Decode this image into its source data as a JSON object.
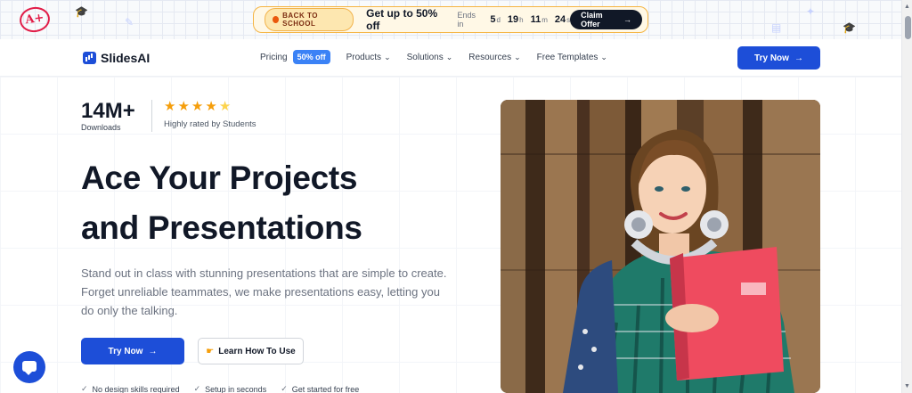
{
  "promo": {
    "tag": "BACK TO SCHOOL",
    "offer_prefix": "Get up to ",
    "offer_highlight": "50% off",
    "ends_label": "Ends in",
    "countdown": [
      {
        "value": "5",
        "unit": "d"
      },
      {
        "value": "19",
        "unit": "h"
      },
      {
        "value": "11",
        "unit": "m"
      },
      {
        "value": "24",
        "unit": "s"
      }
    ],
    "cta": "Claim Offer",
    "doodle_text": "A+"
  },
  "nav": {
    "brand": "SlidesAI",
    "items": [
      {
        "label": "Pricing"
      },
      {
        "label": "Products"
      },
      {
        "label": "Solutions"
      },
      {
        "label": "Resources"
      },
      {
        "label": "Free Templates"
      }
    ],
    "pricing_badge": "50% off",
    "cta": "Try Now"
  },
  "hero": {
    "stat_value": "14M+",
    "stat_label": "Downloads",
    "rating_value": 4.5,
    "rating_label": "Highly rated by Students",
    "headline_line1": "Ace Your Projects",
    "headline_line2": "and Presentations",
    "subtext": "Stand out in class with stunning presentations that are simple to create. Forget unreliable teammates, we make presentations easy, letting you do only the talking.",
    "primary_cta": "Try Now",
    "secondary_cta": "Learn How To Use",
    "features": [
      "No design skills required",
      "Setup in seconds",
      "Get started for free"
    ]
  },
  "colors": {
    "brand_blue": "#1d4ed8",
    "banner_border": "#f5b544",
    "text_dark": "#111827",
    "star": "#f59e0b"
  }
}
